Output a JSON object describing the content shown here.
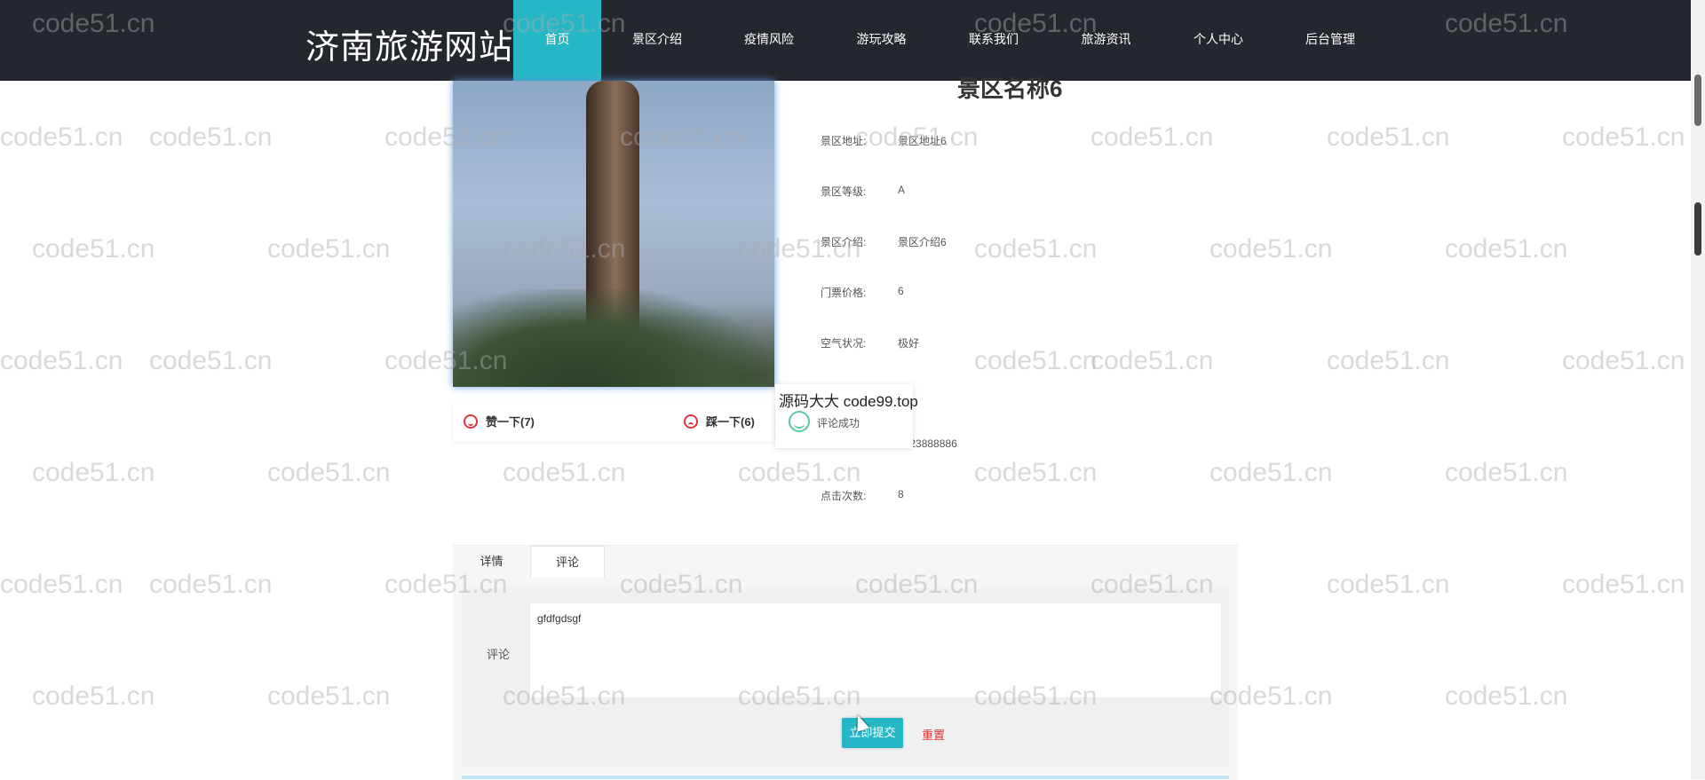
{
  "header": {
    "site_title": "济南旅游网站",
    "nav": [
      "首页",
      "景区介绍",
      "疫情风险",
      "游玩攻略",
      "联系我们",
      "旅游资讯",
      "个人中心",
      "后台管理"
    ],
    "active_index": 0
  },
  "spot": {
    "name": "景区名称6",
    "info": [
      {
        "label": "景区地址:",
        "value": "景区地址6"
      },
      {
        "label": "景区等级:",
        "value": "A"
      },
      {
        "label": "景区介绍:",
        "value": "景区介绍6"
      },
      {
        "label": "门票价格:",
        "value": "6"
      },
      {
        "label": "空气状况:",
        "value": "极好"
      },
      {
        "label": "",
        "value": "1823888886"
      },
      {
        "label": "点击次数:",
        "value": "8"
      }
    ]
  },
  "votes": {
    "like": "赞一下(7)",
    "dislike": "踩一下(6)"
  },
  "toast": {
    "watermark": "源码大大 code99.top",
    "message": "评论成功"
  },
  "tabs": [
    {
      "label": "详情",
      "active": false
    },
    {
      "label": "评论",
      "active": true
    }
  ],
  "comment": {
    "label": "评论",
    "value": "gfdfgdsgf",
    "submit": "立即提交",
    "reset": "重置"
  },
  "watermark_text": "code51.cn",
  "colors": {
    "header_bg": "#24272e",
    "accent": "#26b7c6",
    "reset": "#dd3333",
    "vote_icon": "#e0343b",
    "success": "#5cc79a"
  }
}
